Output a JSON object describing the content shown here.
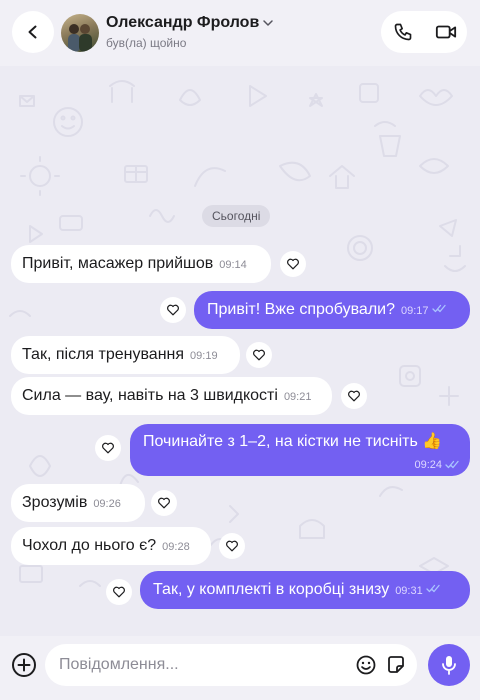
{
  "header": {
    "contact_name": "Олександр Фролов",
    "status": "був(ла) щойно"
  },
  "chat": {
    "date_divider": "Сьогодні",
    "messages": [
      {
        "direction": "in",
        "text": "Привіт, масажер прийшов",
        "time": "09:14"
      },
      {
        "direction": "out",
        "text": "Привіт! Вже спробували?",
        "time": "09:17",
        "read": true
      },
      {
        "direction": "in",
        "text": "Так, після тренування",
        "time": "09:19"
      },
      {
        "direction": "in",
        "text": "Сила — вау, навіть на 3 швидкості",
        "time": "09:21"
      },
      {
        "direction": "out",
        "text": "Починайте з 1–2, на кістки не тисніть 👍",
        "time": "09:24",
        "read": true
      },
      {
        "direction": "in",
        "text": "Зрозумів",
        "time": "09:26"
      },
      {
        "direction": "in",
        "text": "Чохол до нього є?",
        "time": "09:28"
      },
      {
        "direction": "out",
        "text": "Так, у комплекті в коробці знизу",
        "time": "09:31",
        "read": true
      }
    ]
  },
  "composer": {
    "placeholder": "Повідомлення..."
  },
  "icons": {
    "back": "chevron-left-icon",
    "call": "phone-icon",
    "video": "video-camera-icon",
    "react": "heart-icon",
    "attach": "plus-circle-icon",
    "emoji": "smiley-icon",
    "sticker": "sticker-icon",
    "voice": "microphone-icon",
    "read_receipt": "double-check-icon"
  },
  "colors": {
    "accent": "#7360f2",
    "background": "#ecebf3",
    "incoming_bubble": "#ffffff",
    "read_ticks": "#a9c3ff"
  }
}
